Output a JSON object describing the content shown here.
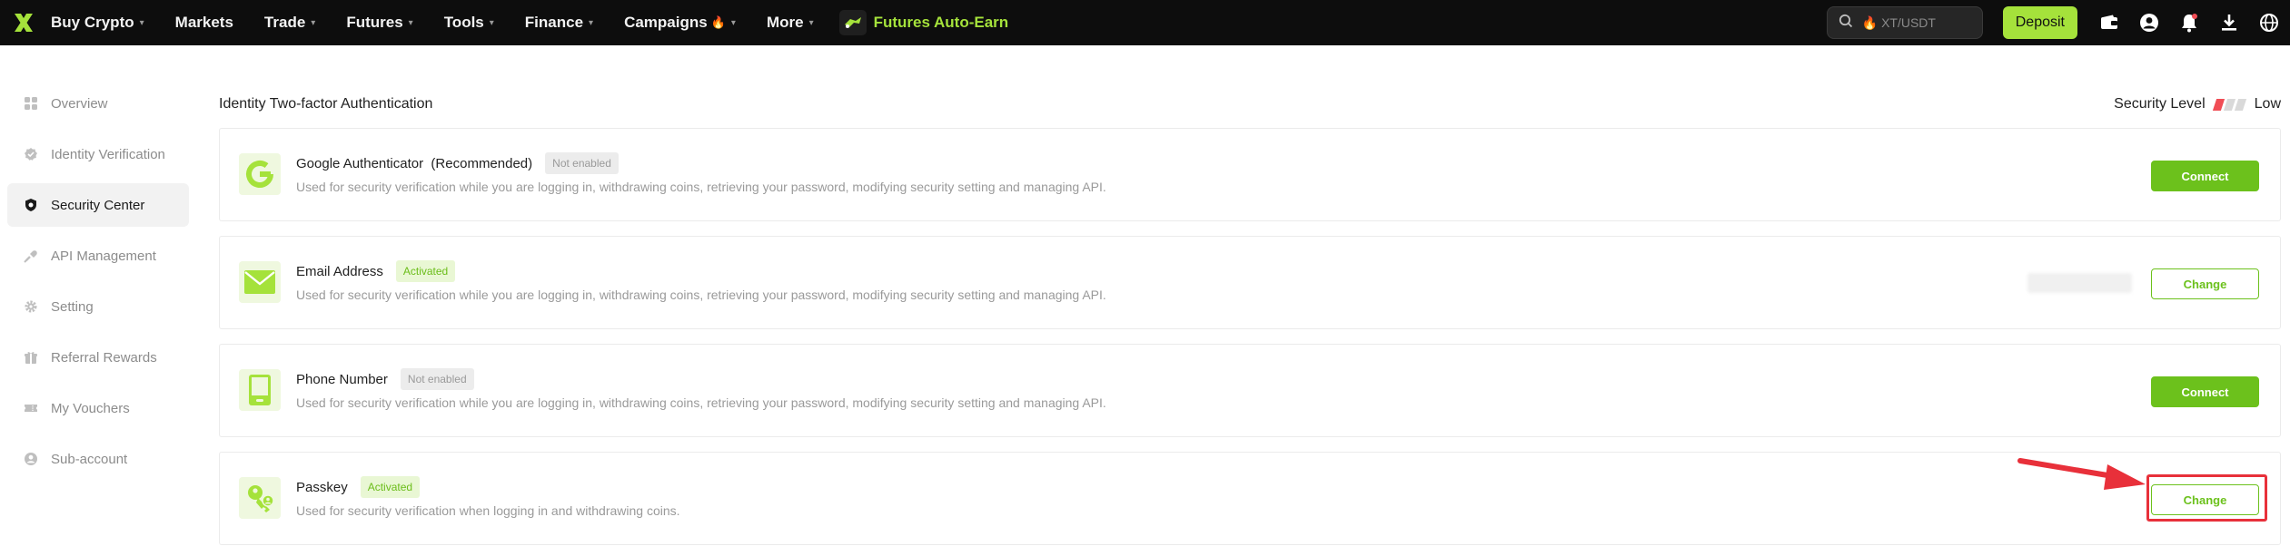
{
  "nav": {
    "items": [
      {
        "label": "Buy Crypto",
        "chevron": true
      },
      {
        "label": "Markets",
        "chevron": false
      },
      {
        "label": "Trade",
        "chevron": true
      },
      {
        "label": "Futures",
        "chevron": true
      },
      {
        "label": "Tools",
        "chevron": true
      },
      {
        "label": "Finance",
        "chevron": true
      },
      {
        "label": "Campaigns",
        "chevron": true,
        "icon": "fire-icon"
      },
      {
        "label": "More",
        "chevron": true
      }
    ],
    "promo_label": "Futures Auto-Earn",
    "search_placeholder": "XT/USDT",
    "deposit_label": "Deposit",
    "right_icons": [
      "wallet-icon",
      "user-icon",
      "bell-icon",
      "download-icon",
      "globe-icon"
    ]
  },
  "sidebar": {
    "items": [
      {
        "label": "Overview",
        "icon": "grid-icon",
        "active": false
      },
      {
        "label": "Identity Verification",
        "icon": "verified-icon",
        "active": false
      },
      {
        "label": "Security Center",
        "icon": "shield-icon",
        "active": true
      },
      {
        "label": "API Management",
        "icon": "api-icon",
        "active": false
      },
      {
        "label": "Setting",
        "icon": "gear-icon",
        "active": false
      },
      {
        "label": "Referral Rewards",
        "icon": "gift-icon",
        "active": false
      },
      {
        "label": "My Vouchers",
        "icon": "ticket-icon",
        "active": false
      },
      {
        "label": "Sub-account",
        "icon": "account-icon",
        "active": false
      }
    ]
  },
  "main": {
    "title": "Identity Two-factor Authentication",
    "security_level_label": "Security Level",
    "security_level_value": "Low",
    "security_level_bars": {
      "filled": 1,
      "total": 3
    },
    "cards": [
      {
        "title": "Google Authenticator  (Recommended)",
        "status": "Not enabled",
        "status_on": false,
        "desc": "Used for security verification while you are logging in, withdrawing coins, retrieving your password, modifying security setting and managing API.",
        "button": "Connect",
        "icon": "google-authenticator-icon"
      },
      {
        "title": "Email Address",
        "status": "Activated",
        "status_on": true,
        "desc": "Used for security verification while you are logging in, withdrawing coins, retrieving your password, modifying security setting and managing API.",
        "button": "Change",
        "icon": "email-icon",
        "masked_value": true
      },
      {
        "title": "Phone Number",
        "status": "Not enabled",
        "status_on": false,
        "desc": "Used for security verification while you are logging in, withdrawing coins, retrieving your password, modifying security setting and managing API.",
        "button": "Connect",
        "icon": "phone-icon"
      },
      {
        "title": "Passkey",
        "status": "Activated",
        "status_on": true,
        "desc": "Used for security verification when logging in and withdrawing coins.",
        "button": "Change",
        "icon": "passkey-icon"
      }
    ]
  },
  "colors": {
    "brand_green": "#a5e23b",
    "button_green": "#6cc11c",
    "annotation_red": "#e8303a"
  }
}
